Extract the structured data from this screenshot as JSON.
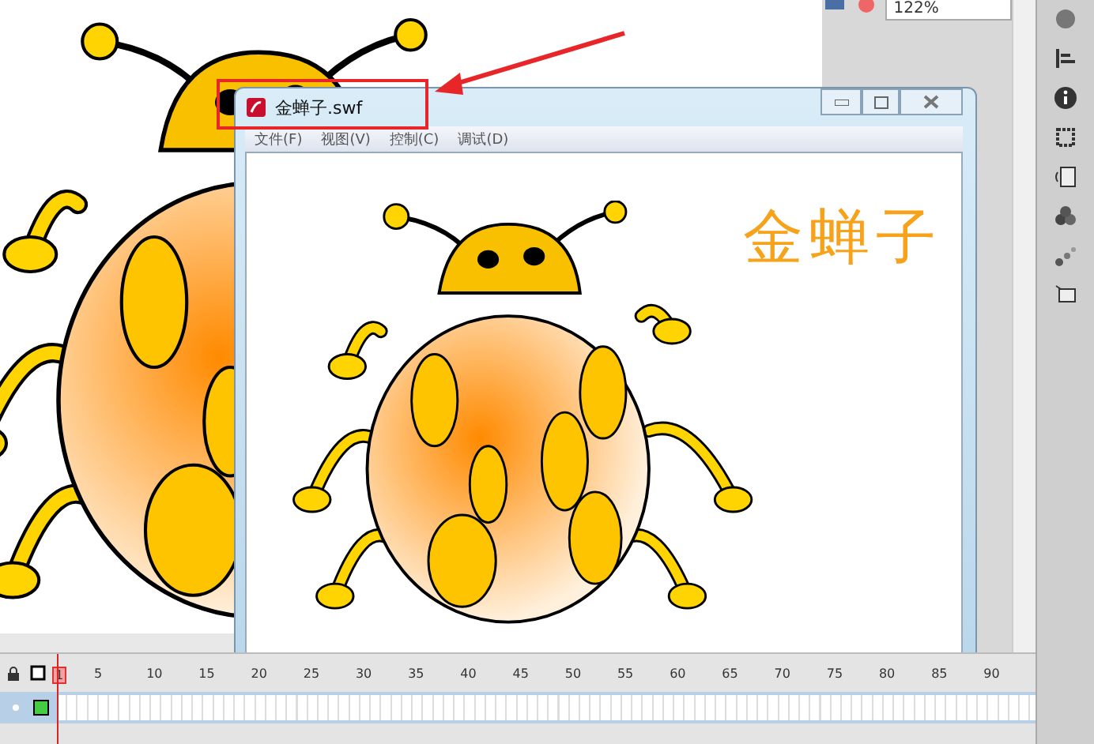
{
  "toolbar": {
    "zoom": "122%"
  },
  "player_window": {
    "title": "金蝉子.swf",
    "menu": [
      "文件(F)",
      "视图(V)",
      "控制(C)",
      "调试(D)"
    ],
    "movie_text": "金蝉子"
  },
  "timeline": {
    "frames": [
      {
        "label": "1",
        "selected": true
      },
      {
        "label": "5",
        "selected": false
      },
      {
        "label": "10",
        "selected": false
      },
      {
        "label": "15",
        "selected": false
      },
      {
        "label": "20",
        "selected": false
      },
      {
        "label": "25",
        "selected": false
      },
      {
        "label": "30",
        "selected": false
      },
      {
        "label": "35",
        "selected": false
      },
      {
        "label": "40",
        "selected": false
      },
      {
        "label": "45",
        "selected": false
      },
      {
        "label": "50",
        "selected": false
      },
      {
        "label": "55",
        "selected": false
      },
      {
        "label": "60",
        "selected": false
      },
      {
        "label": "65",
        "selected": false
      },
      {
        "label": "70",
        "selected": false
      },
      {
        "label": "75",
        "selected": false
      },
      {
        "label": "80",
        "selected": false
      },
      {
        "label": "85",
        "selected": false
      },
      {
        "label": "90",
        "selected": false
      }
    ],
    "layers": [
      {
        "selected": true
      }
    ]
  }
}
